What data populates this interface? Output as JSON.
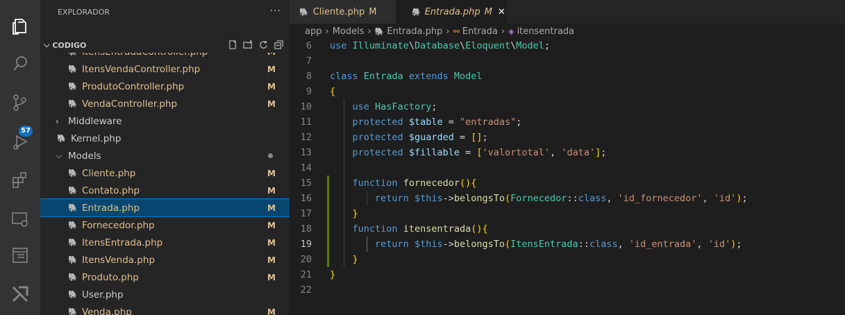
{
  "activity_bar": {
    "scm_badge": "57",
    "colors": {
      "background": "#333333",
      "badge": "#0e70c0"
    }
  },
  "sidebar": {
    "title": "EXPLORADOR",
    "more": "···",
    "section": "CODIGO",
    "items": [
      {
        "label": "ItensEntradaController.php",
        "git": "M",
        "type": "file",
        "indent": 2
      },
      {
        "label": "ItensVendaController.php",
        "git": "M",
        "type": "file",
        "indent": 2
      },
      {
        "label": "ProdutoController.php",
        "git": "M",
        "type": "file",
        "indent": 2
      },
      {
        "label": "VendaController.php",
        "git": "M",
        "type": "file",
        "indent": 2
      },
      {
        "label": "Middleware",
        "git": "",
        "type": "folder-collapsed",
        "indent": 1
      },
      {
        "label": "Kernel.php",
        "git": "",
        "type": "file",
        "indent": 1
      },
      {
        "label": "Models",
        "git": "dot",
        "type": "folder-open",
        "indent": 1
      },
      {
        "label": "Cliente.php",
        "git": "M",
        "type": "file",
        "indent": 2
      },
      {
        "label": "Contato.php",
        "git": "M",
        "type": "file",
        "indent": 2
      },
      {
        "label": "Entrada.php",
        "git": "M",
        "type": "file",
        "indent": 2,
        "selected": true
      },
      {
        "label": "Fornecedor.php",
        "git": "M",
        "type": "file",
        "indent": 2
      },
      {
        "label": "ItensEntrada.php",
        "git": "M",
        "type": "file",
        "indent": 2
      },
      {
        "label": "ItensVenda.php",
        "git": "M",
        "type": "file",
        "indent": 2
      },
      {
        "label": "Produto.php",
        "git": "M",
        "type": "file",
        "indent": 2
      },
      {
        "label": "User.php",
        "git": "",
        "type": "file",
        "indent": 2
      },
      {
        "label": "Venda.php",
        "git": "M",
        "type": "file",
        "indent": 2
      }
    ]
  },
  "tabs": [
    {
      "label": "Cliente.php",
      "status": "M",
      "active": false
    },
    {
      "label": "Entrada.php",
      "status": "M",
      "active": true,
      "close": "✕"
    }
  ],
  "breadcrumb": {
    "parts": [
      "app",
      "Models",
      "Entrada.php",
      "Entrada",
      "itensentrada"
    ],
    "separator": "›"
  },
  "editor": {
    "lines": [
      {
        "n": "6",
        "text": "use Illuminate\\Database\\Eloquent\\Model;"
      },
      {
        "n": "7",
        "text": ""
      },
      {
        "n": "8",
        "text": "class Entrada extends Model"
      },
      {
        "n": "9",
        "text": "{"
      },
      {
        "n": "10",
        "text": "    use HasFactory;"
      },
      {
        "n": "11",
        "text": "    protected $table = \"entradas\";"
      },
      {
        "n": "12",
        "text": "    protected $guarded = [];"
      },
      {
        "n": "13",
        "text": "    protected $fillable = ['valortotal', 'data'];"
      },
      {
        "n": "14",
        "text": ""
      },
      {
        "n": "15",
        "text": "    function fornecedor(){"
      },
      {
        "n": "16",
        "text": "        return $this->belongsTo(Fornecedor::class, 'id_fornecedor', 'id');"
      },
      {
        "n": "17",
        "text": "    }"
      },
      {
        "n": "18",
        "text": "    function itensentrada(){"
      },
      {
        "n": "19",
        "text": "        return $this->belongsTo(ItensEntrada::class, 'id_entrada', 'id');"
      },
      {
        "n": "20",
        "text": "    }"
      },
      {
        "n": "21",
        "text": "}"
      },
      {
        "n": "22",
        "text": ""
      }
    ],
    "current_line": "19"
  }
}
